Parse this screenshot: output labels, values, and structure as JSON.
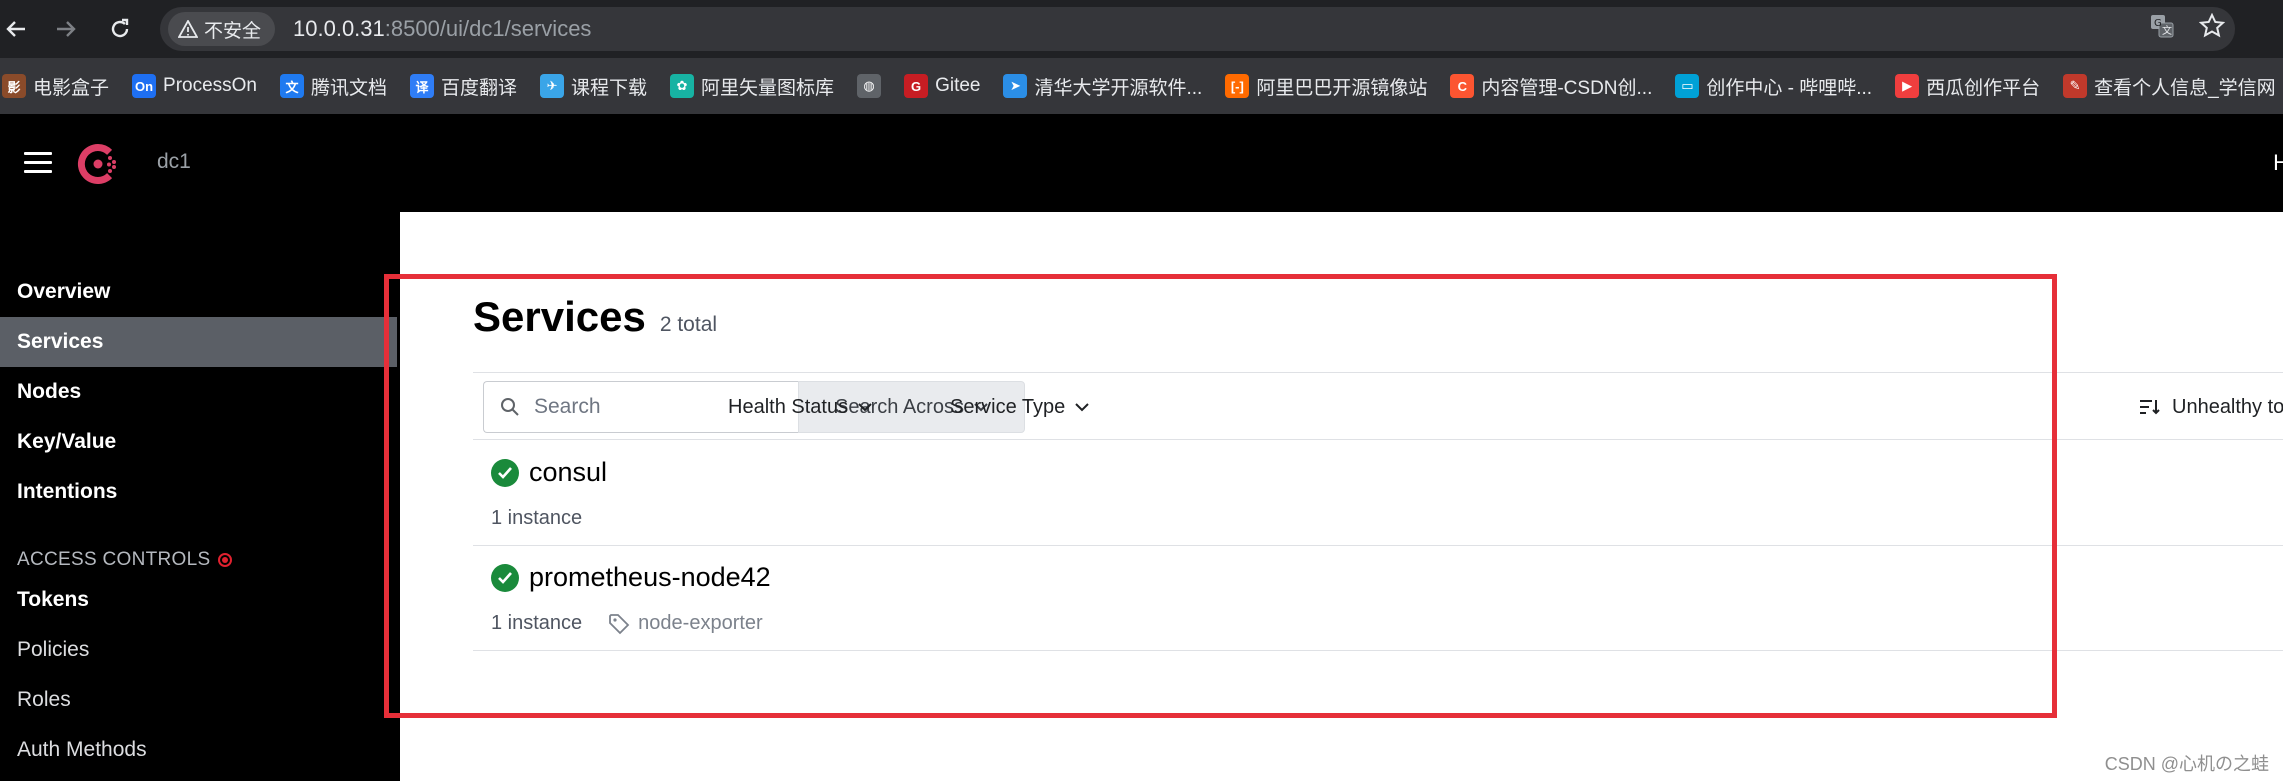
{
  "browser": {
    "security_label": "不安全",
    "url_host": "10.0.0.31",
    "url_rest": ":8500/ui/dc1/services",
    "bookmarks": [
      {
        "label": "电影盒子",
        "icon": "movie-box-icon",
        "color": "#8a4b2a",
        "glyph": "影"
      },
      {
        "label": "ProcessOn",
        "icon": "processon-icon",
        "color": "#1e6ff2",
        "glyph": "On"
      },
      {
        "label": "腾讯文档",
        "icon": "tencent-docs-icon",
        "color": "#1f7af0",
        "glyph": "文"
      },
      {
        "label": "百度翻译",
        "icon": "baidu-translate-icon",
        "color": "#2f7df6",
        "glyph": "译"
      },
      {
        "label": "课程下载",
        "icon": "course-download-icon",
        "color": "#3aa5e8",
        "glyph": "✈"
      },
      {
        "label": "阿里矢量图标库",
        "icon": "iconfont-icon",
        "color": "#17b3a3",
        "glyph": "✿"
      },
      {
        "label": "",
        "icon": "globe-icon",
        "color": "#5f6368",
        "glyph": "◍"
      },
      {
        "label": "Gitee",
        "icon": "gitee-icon",
        "color": "#c71d23",
        "glyph": "G"
      },
      {
        "label": "清华大学开源软件...",
        "icon": "tsinghua-mirror-icon",
        "color": "#2b8ee6",
        "glyph": "➤"
      },
      {
        "label": "阿里巴巴开源镜像站",
        "icon": "aliyun-mirror-icon",
        "color": "#ff6a00",
        "glyph": "[-]"
      },
      {
        "label": "内容管理-CSDN创...",
        "icon": "csdn-icon",
        "color": "#fc5531",
        "glyph": "C"
      },
      {
        "label": "创作中心 - 哔哩哔...",
        "icon": "bilibili-icon",
        "color": "#00a1d6",
        "glyph": "▭"
      },
      {
        "label": "西瓜创作平台",
        "icon": "xigua-icon",
        "color": "#f03e3e",
        "glyph": "▶"
      },
      {
        "label": "查看个人信息_学信网",
        "icon": "chsi-icon",
        "color": "#c0392b",
        "glyph": "✎"
      }
    ]
  },
  "header": {
    "datacenter": "dc1",
    "right_text": "H"
  },
  "sidebar": {
    "items": [
      {
        "label": "Overview"
      },
      {
        "label": "Services"
      },
      {
        "label": "Nodes"
      },
      {
        "label": "Key/Value"
      },
      {
        "label": "Intentions"
      }
    ],
    "access_controls_label": "ACCESS CONTROLS",
    "acl_items": [
      {
        "label": "Tokens"
      },
      {
        "label": "Policies"
      },
      {
        "label": "Roles"
      },
      {
        "label": "Auth Methods"
      }
    ]
  },
  "main": {
    "title": "Services",
    "total": "2 total",
    "search_placeholder": "Search",
    "search_across": "Search Across",
    "health_status": "Health Status",
    "service_type": "Service Type",
    "sort_label": "Unhealthy to Healthy",
    "services": [
      {
        "name": "consul",
        "instances": "1 instance",
        "tag": ""
      },
      {
        "name": "prometheus-node42",
        "instances": "1 instance",
        "tag": "node-exporter"
      }
    ]
  },
  "watermark": "CSDN @心机の之蛙",
  "colors": {
    "health_passing": "#1a8a3b",
    "highlight_box": "#e62f39",
    "consul_brand": "#dc3e66"
  }
}
